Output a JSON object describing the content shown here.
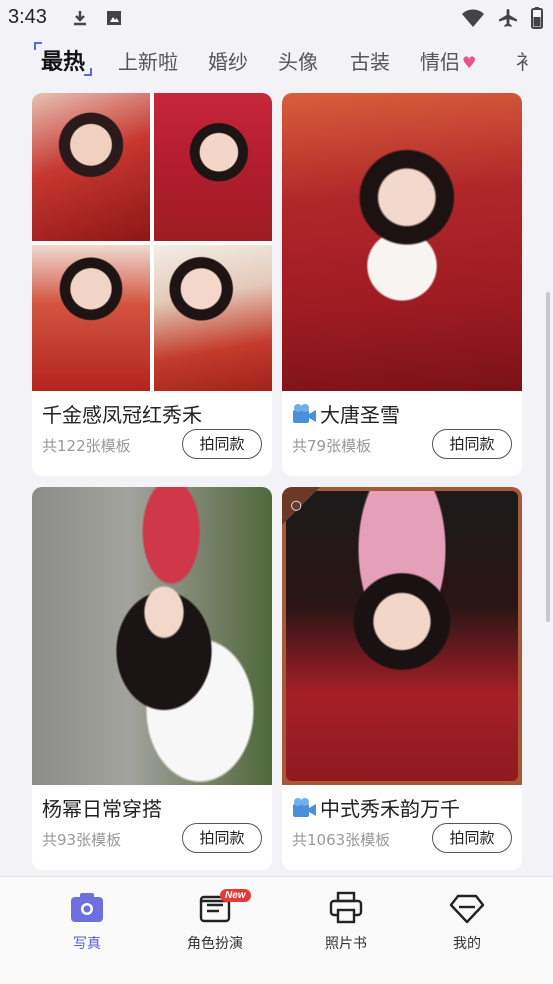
{
  "status_bar": {
    "time": "3:43",
    "left_icons": [
      "download-icon",
      "photo-icon"
    ],
    "right_icons": [
      "wifi-icon",
      "airplane-icon",
      "battery-icon"
    ]
  },
  "tabs": [
    {
      "label": "最热",
      "active": true
    },
    {
      "label": "上新啦",
      "active": false
    },
    {
      "label": "婚纱",
      "active": false
    },
    {
      "label": "头像",
      "active": false
    },
    {
      "label": "古装",
      "active": false
    },
    {
      "label": "情侣",
      "active": false,
      "icon": "heart-icon"
    },
    {
      "label": "衤",
      "active": false
    }
  ],
  "cards": [
    {
      "title": "千金感凤冠红秀禾",
      "count": "共122张模板",
      "button": "拍同款",
      "video": false
    },
    {
      "title": "大唐圣雪",
      "count": "共79张模板",
      "button": "拍同款",
      "video": true
    },
    {
      "title": "杨幂日常穿搭",
      "count": "共93张模板",
      "button": "拍同款",
      "video": false
    },
    {
      "title": "中式秀禾韵万千",
      "count": "共1063张模板",
      "button": "拍同款",
      "video": true
    }
  ],
  "bottom_nav": [
    {
      "label": "写真",
      "icon": "camera-icon",
      "active": true
    },
    {
      "label": "角色扮演",
      "icon": "script-icon",
      "active": false,
      "badge": "New"
    },
    {
      "label": "照片书",
      "icon": "printer-icon",
      "active": false
    },
    {
      "label": "我的",
      "icon": "diamond-icon",
      "active": false
    }
  ],
  "colors": {
    "accent": "#5a5fd6",
    "badge": "#e53935",
    "background": "#f2f2f7"
  }
}
